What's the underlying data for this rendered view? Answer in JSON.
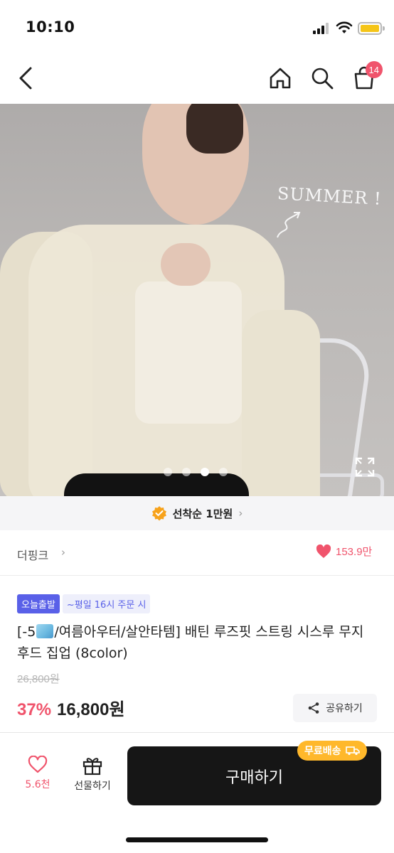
{
  "status_bar": {
    "time": "10:10"
  },
  "header": {
    "cart_count": "14"
  },
  "gallery": {
    "overlay_text": "SUMMER !",
    "dots_total": 4,
    "dots_active": 3
  },
  "promo": {
    "label": "선착순 1만원"
  },
  "brand": {
    "name": "더핑크",
    "likes": "153.9만"
  },
  "product": {
    "badge_today": "오늘출발",
    "badge_note": "~평일 16시 주문 시",
    "title_prefix": "[-5",
    "title_rest": "/여름아우터/살안타템] 배틴 루즈핏 스트링 시스루 무지 후드 집업 (8color)",
    "original_price": "26,800원",
    "discount": "37%",
    "price": "16,800원",
    "share_label": "공유하기"
  },
  "bottom_bar": {
    "like_count": "5.6천",
    "gift_label": "선물하기",
    "buy_label": "구매하기",
    "free_shipping": "무료배송"
  },
  "colors": {
    "accent": "#f0546c",
    "primary_badge": "#5960e8",
    "buy_button": "#161616",
    "free_ship": "#ffb82b"
  }
}
